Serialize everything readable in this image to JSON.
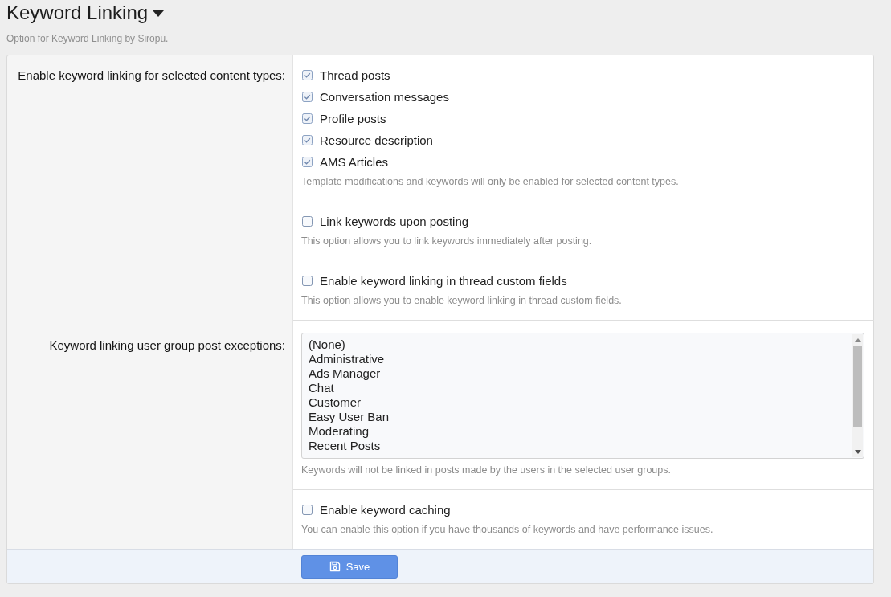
{
  "header": {
    "title": "Keyword Linking",
    "description": "Option for Keyword Linking by Siropu."
  },
  "rows": [
    {
      "label": "Enable keyword linking for selected content types:",
      "controls": [
        {
          "kind": "checkboxes",
          "options": [
            {
              "label": "Thread posts",
              "checked": true
            },
            {
              "label": "Conversation messages",
              "checked": true
            },
            {
              "label": "Profile posts",
              "checked": true
            },
            {
              "label": "Resource description",
              "checked": true
            },
            {
              "label": "AMS Articles",
              "checked": true
            }
          ],
          "hint": "Template modifications and keywords will only be enabled for selected content types."
        },
        {
          "kind": "checkboxes",
          "options": [
            {
              "label": "Link keywords upon posting",
              "checked": false
            }
          ],
          "hint": "This option allows you to link keywords immediately after posting."
        },
        {
          "kind": "checkboxes",
          "options": [
            {
              "label": "Enable keyword linking in thread custom fields",
              "checked": false
            }
          ],
          "hint": "This option allows you to enable keyword linking in thread custom fields."
        }
      ]
    },
    {
      "label": "Keyword linking user group post exceptions:",
      "controls": [
        {
          "kind": "listbox",
          "options": [
            {
              "label": "(None)",
              "selected": false
            },
            {
              "label": "Administrative",
              "selected": false
            },
            {
              "label": "Ads Manager",
              "selected": false
            },
            {
              "label": "Chat",
              "selected": false
            },
            {
              "label": "Customer",
              "selected": false
            },
            {
              "label": "Easy User Ban",
              "selected": false
            },
            {
              "label": "Moderating",
              "selected": false
            },
            {
              "label": "Recent Posts",
              "selected": false
            }
          ],
          "hint": "Keywords will not be linked in posts made by the users in the selected user groups."
        }
      ]
    },
    {
      "controls": [
        {
          "kind": "checkboxes",
          "options": [
            {
              "label": "Enable keyword caching",
              "checked": false
            }
          ],
          "hint": "You can enable this option if you have thousands of keywords and have performance issues."
        }
      ]
    }
  ],
  "save_button": {
    "label": "Save"
  }
}
